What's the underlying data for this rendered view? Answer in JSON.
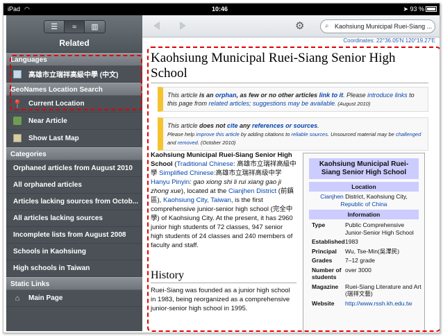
{
  "status_bar": {
    "device": "iPad",
    "wifi_icon": "wifi-icon",
    "time": "10:46",
    "battery": "93 %"
  },
  "sidebar": {
    "title": "Related",
    "segments": [
      {
        "icon": "list-icon",
        "glyph": "☰"
      },
      {
        "icon": "waves-icon",
        "glyph": "≈"
      },
      {
        "icon": "book-icon",
        "glyph": "📖"
      }
    ],
    "sections": {
      "languages": "Languages",
      "geonames": "GeoNames Location Search",
      "categories": "Categories",
      "static_links": "Static Links"
    },
    "language_item": "高雄市立瑞祥高級中學 (中文)",
    "current_location": "Current Location",
    "near_article": "Near Article",
    "show_last_map": "Show Last Map",
    "categories": [
      "Orphaned articles from August 2010",
      "All orphaned articles",
      "Articles lacking sources from Octob...",
      "All articles lacking sources",
      "Incomplete lists from August 2008",
      "Schools in Kaohsiung",
      "High schools in Taiwan"
    ],
    "main_page": "Main Page"
  },
  "toolbar": {
    "search_value": "Kaohsiung Municipal Ruei-Siang ...",
    "coordinates": "Coordinates: 22°36.05′N 120°19.27′E"
  },
  "article": {
    "title": "Kaohsiung Municipal Ruei-Siang Senior High School",
    "notice1": {
      "a": "This article ",
      "b": "is an ",
      "c": "orphan",
      "d": ", as few or no other articles ",
      "e": "link to it",
      "f": ". Please ",
      "g": "introduce links",
      "h": " to this page from ",
      "i": "related articles; suggestions may be available",
      "j": ". (August 2010)"
    },
    "notice2": {
      "a": "This article ",
      "b": "does not ",
      "c": "cite",
      "d": " any ",
      "e": "references or sources",
      "f": ".",
      "g": "Please help ",
      "h": "improve this article",
      "i": " by adding citations to ",
      "j": "reliable sources",
      "k": ". Unsourced material may be ",
      "l": "challenged",
      "m": " and ",
      "n": "removed",
      "o": ". (October 2010)"
    },
    "intro": {
      "name": "Kaohsiung Municipal Ruei-Siang Senior High School",
      "p1": " (",
      "trad_link": "Traditional Chinese",
      "trad": ": 高雄市立瑞祥高級中學 ",
      "simp_link": "Simplified Chinese",
      "simp": ":高雄市立瑞祥高级中学 ",
      "pinyin_link": "Hanyu Pinyin",
      "pinyin": ": gao xiong shi li rui xiang gao ji zhong xue",
      "p2": "), located at the ",
      "district_link": "Cianjhen District",
      "p3": " (前鎮區), ",
      "city_link": "Kaohsiung City, Taiwan",
      "p4": ", is the first comprehensive junior-senior high school (完全中學) of Kaohsiung City. At the present, it has 2960 junior high students of 72 classes, 947 senior high students of 24 classes and 240 members of faculty and staff."
    },
    "history_heading": "History",
    "history_text": "Ruei-Siang was founded as a junior high school in 1983, being reorganized as a comprehensive junior-senior high school in 1995."
  },
  "infobox": {
    "title": "Kaohsiung Municipal Ruei-Siang Senior High School",
    "location_head": "Location",
    "location_link1": "Cianjhen",
    "location_mid": " District, Kaohsiung City,",
    "location_link2": "Republic of China",
    "information_head": "Information",
    "rows": [
      {
        "label": "Type",
        "value": "Public Comprehensive Junior-Senior High School"
      },
      {
        "label": "Established",
        "value": "1983"
      },
      {
        "label": "Principal",
        "value": "Wu, Tse-Min(吳澤民)"
      },
      {
        "label": "Grades",
        "value": "7–12 grade"
      },
      {
        "label": "Number of students",
        "value": "over 3000"
      },
      {
        "label": "Magazine",
        "value": "Ruei-Siang Literature and Art (瑞祥文藝)"
      }
    ],
    "website_label": "Website",
    "website_value": "http://www.rssh.kh.edu.tw"
  }
}
